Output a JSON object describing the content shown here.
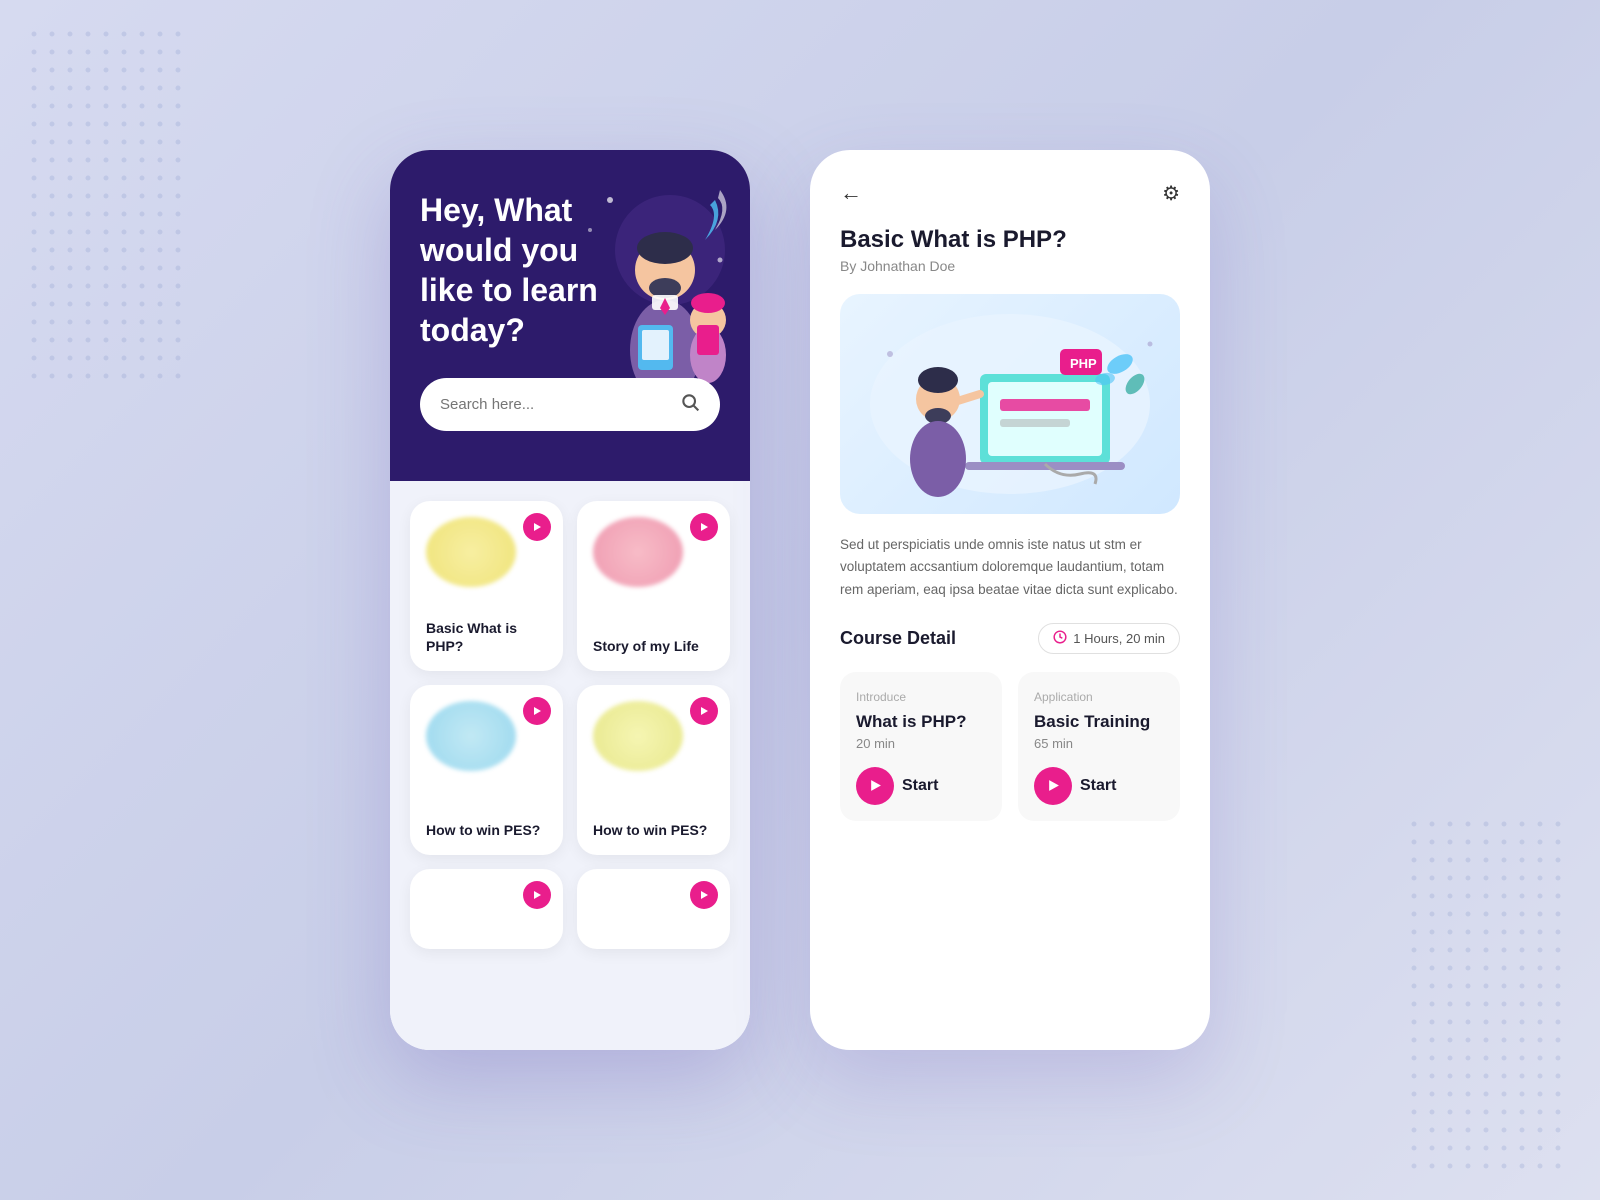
{
  "background": {
    "color": "#d0d5ee"
  },
  "left_phone": {
    "header": {
      "title": "Hey, What would you like to learn today?",
      "search_placeholder": "Search here..."
    },
    "cards": [
      {
        "id": "card1",
        "title": "Basic What is PHP?",
        "blob": "yellow"
      },
      {
        "id": "card2",
        "title": "Story of my Life",
        "blob": "pink"
      },
      {
        "id": "card3",
        "title": "How to win PES?",
        "blob": "blue"
      },
      {
        "id": "card4",
        "title": "How to win PES?",
        "blob": "yellow2"
      }
    ]
  },
  "right_phone": {
    "back_label": "←",
    "gear_label": "⚙",
    "course_title": "Basic What is PHP?",
    "course_author": "By Johnathan Doe",
    "description": "Sed ut perspiciatis unde omnis iste natus ut stm er voluptatem accsantium doloremque laudantium, totam rem aperiam, eaq ipsa beatae vitae dicta sunt explicabo.",
    "course_detail_label": "Course Detail",
    "duration": "1 Hours, 20 min",
    "modules": [
      {
        "type": "Introduce",
        "name": "What is PHP?",
        "duration": "20 min",
        "start_label": "Start"
      },
      {
        "type": "Application",
        "name": "Basic Training",
        "duration": "65 min",
        "start_label": "Start"
      }
    ]
  }
}
